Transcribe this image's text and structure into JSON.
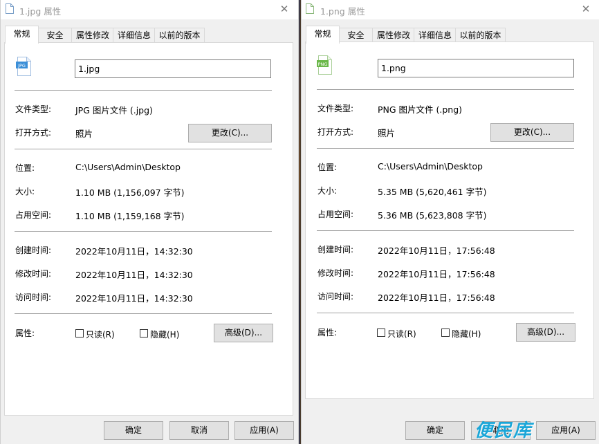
{
  "tabs": [
    "常规",
    "安全",
    "属性修改",
    "详细信息",
    "以前的版本"
  ],
  "labels": {
    "type": "文件类型:",
    "open_with": "打开方式:",
    "location": "位置:",
    "size": "大小:",
    "size_on_disk": "占用空间:",
    "created": "创建时间:",
    "modified": "修改时间:",
    "accessed": "访问时间:",
    "attributes": "属性:"
  },
  "buttons": {
    "change": "更改(C)...",
    "advanced": "高级(D)...",
    "readonly": "只读(R)",
    "hidden": "隐藏(H)",
    "ok": "确定",
    "cancel": "取消",
    "apply": "应用(A)"
  },
  "icons": {
    "close": "close-icon",
    "file_jpg": "jpg-file-icon",
    "file_png": "png-file-icon"
  },
  "left": {
    "title": "1.jpg 属性",
    "icon_badge": "JPG",
    "filename": "1.jpg",
    "file_type": "JPG 图片文件 (.jpg)",
    "open_with": "照片",
    "location": "C:\\Users\\Admin\\Desktop",
    "size": "1.10 MB (1,156,097 字节)",
    "size_on_disk": "1.10 MB (1,159,168 字节)",
    "created": "2022年10月11日，14:32:30",
    "modified": "2022年10月11日，14:32:30",
    "accessed": "2022年10月11日，14:32:30"
  },
  "right": {
    "title": "1.png 属性",
    "icon_badge": "PNG",
    "filename": "1.png",
    "file_type": "PNG 图片文件 (.png)",
    "open_with": "照片",
    "location": "C:\\Users\\Admin\\Desktop",
    "size": "5.35 MB (5,620,461 字节)",
    "size_on_disk": "5.36 MB (5,623,808 字节)",
    "created": "2022年10月11日，17:56:48",
    "modified": "2022年10月11日，17:56:48",
    "accessed": "2022年10月11日，17:56:48"
  },
  "watermark": "便民库",
  "colors": {
    "jpg_icon": "#3b8fd8",
    "png_icon": "#6bb84a",
    "watermark": "#1aa6d8"
  }
}
